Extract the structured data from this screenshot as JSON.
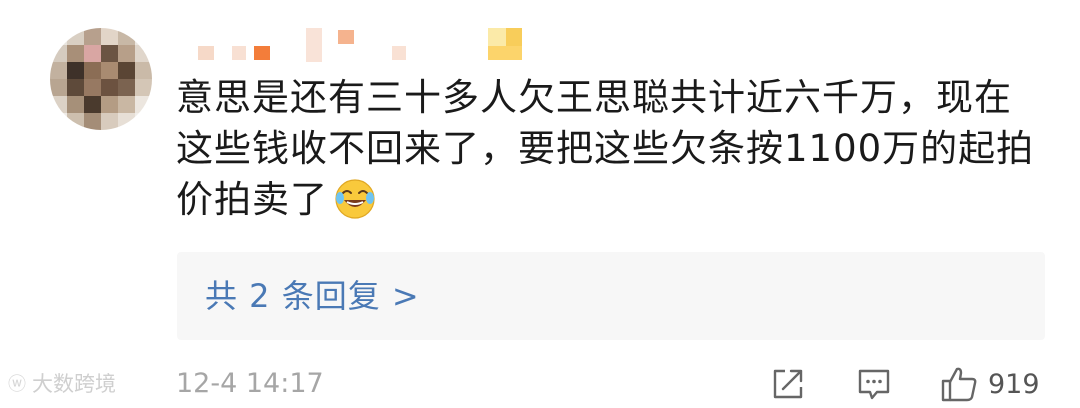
{
  "comment": {
    "text_lines": [
      "意思是还有三十多人欠王思聪共计近六千万，现在",
      "这些钱收不回来了，要把这些欠条按1100万的起拍",
      "价拍卖了"
    ],
    "emoji": "laughing-tears-emoji"
  },
  "replies": {
    "link_label": "共 2 条回复 >"
  },
  "footer": {
    "timestamp": "12-4 14:17",
    "like_count": "919",
    "watermark": "大数跨境"
  },
  "icons": {
    "share": "share-icon",
    "comment": "comment-icon",
    "like": "thumbs-up-icon"
  },
  "colors": {
    "text": "#1a1a1a",
    "link": "#4a79b5",
    "meta": "#a6a6a6",
    "reply_bg": "#f7f7f7"
  }
}
